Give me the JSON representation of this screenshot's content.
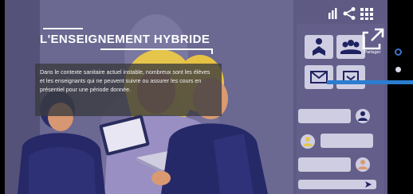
{
  "slide": {
    "title": "L'ENSEIGNEMENT HYBRIDE",
    "description": "Dans le contexte sanitaire actuel instable, nombreux sont les élèves et les enseignants qui ne peuvent suivre ou assurer les cours en présentiel pour une période donnée."
  },
  "share": {
    "label": "Partager",
    "icon": "share-external-icon"
  },
  "top_icons": [
    "signal-bars-icon",
    "share-icon",
    "grid-icon"
  ],
  "tiles": [
    "book-reader-icon",
    "group-icon",
    "mail-icon",
    "inbox-icon"
  ],
  "chat": {
    "avatars": [
      "user-avatar-icon",
      "user-avatar-icon",
      "user-avatar-icon"
    ],
    "send_icon": "send-icon"
  },
  "navigation": {
    "dots": 2,
    "active": 1
  },
  "colors": {
    "background": "#6a6690",
    "navy": "#1e2260",
    "accent_yellow": "#e8c840",
    "accent_blue": "#2a7dd0",
    "skin": "#d99a72",
    "panel": "#3a3a3e"
  }
}
